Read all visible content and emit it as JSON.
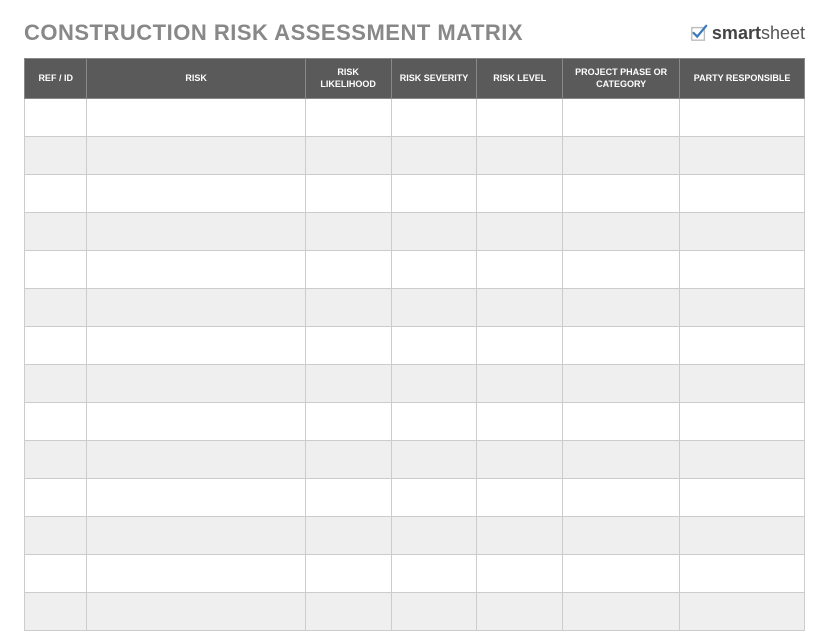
{
  "title": "CONSTRUCTION RISK ASSESSMENT MATRIX",
  "brand": {
    "name": "smartsheet"
  },
  "columns": [
    {
      "label": "REF / ID"
    },
    {
      "label": "RISK"
    },
    {
      "label": "RISK LIKELIHOOD"
    },
    {
      "label": "RISK SEVERITY"
    },
    {
      "label": "RISK LEVEL"
    },
    {
      "label": "PROJECT PHASE OR CATEGORY"
    },
    {
      "label": "PARTY RESPONSIBLE"
    }
  ],
  "rows": [
    {
      "ref": "",
      "risk": "",
      "likelihood": "",
      "severity": "",
      "level": "",
      "phase": "",
      "party": ""
    },
    {
      "ref": "",
      "risk": "",
      "likelihood": "",
      "severity": "",
      "level": "",
      "phase": "",
      "party": ""
    },
    {
      "ref": "",
      "risk": "",
      "likelihood": "",
      "severity": "",
      "level": "",
      "phase": "",
      "party": ""
    },
    {
      "ref": "",
      "risk": "",
      "likelihood": "",
      "severity": "",
      "level": "",
      "phase": "",
      "party": ""
    },
    {
      "ref": "",
      "risk": "",
      "likelihood": "",
      "severity": "",
      "level": "",
      "phase": "",
      "party": ""
    },
    {
      "ref": "",
      "risk": "",
      "likelihood": "",
      "severity": "",
      "level": "",
      "phase": "",
      "party": ""
    },
    {
      "ref": "",
      "risk": "",
      "likelihood": "",
      "severity": "",
      "level": "",
      "phase": "",
      "party": ""
    },
    {
      "ref": "",
      "risk": "",
      "likelihood": "",
      "severity": "",
      "level": "",
      "phase": "",
      "party": ""
    },
    {
      "ref": "",
      "risk": "",
      "likelihood": "",
      "severity": "",
      "level": "",
      "phase": "",
      "party": ""
    },
    {
      "ref": "",
      "risk": "",
      "likelihood": "",
      "severity": "",
      "level": "",
      "phase": "",
      "party": ""
    },
    {
      "ref": "",
      "risk": "",
      "likelihood": "",
      "severity": "",
      "level": "",
      "phase": "",
      "party": ""
    },
    {
      "ref": "",
      "risk": "",
      "likelihood": "",
      "severity": "",
      "level": "",
      "phase": "",
      "party": ""
    },
    {
      "ref": "",
      "risk": "",
      "likelihood": "",
      "severity": "",
      "level": "",
      "phase": "",
      "party": ""
    },
    {
      "ref": "",
      "risk": "",
      "likelihood": "",
      "severity": "",
      "level": "",
      "phase": "",
      "party": ""
    }
  ]
}
